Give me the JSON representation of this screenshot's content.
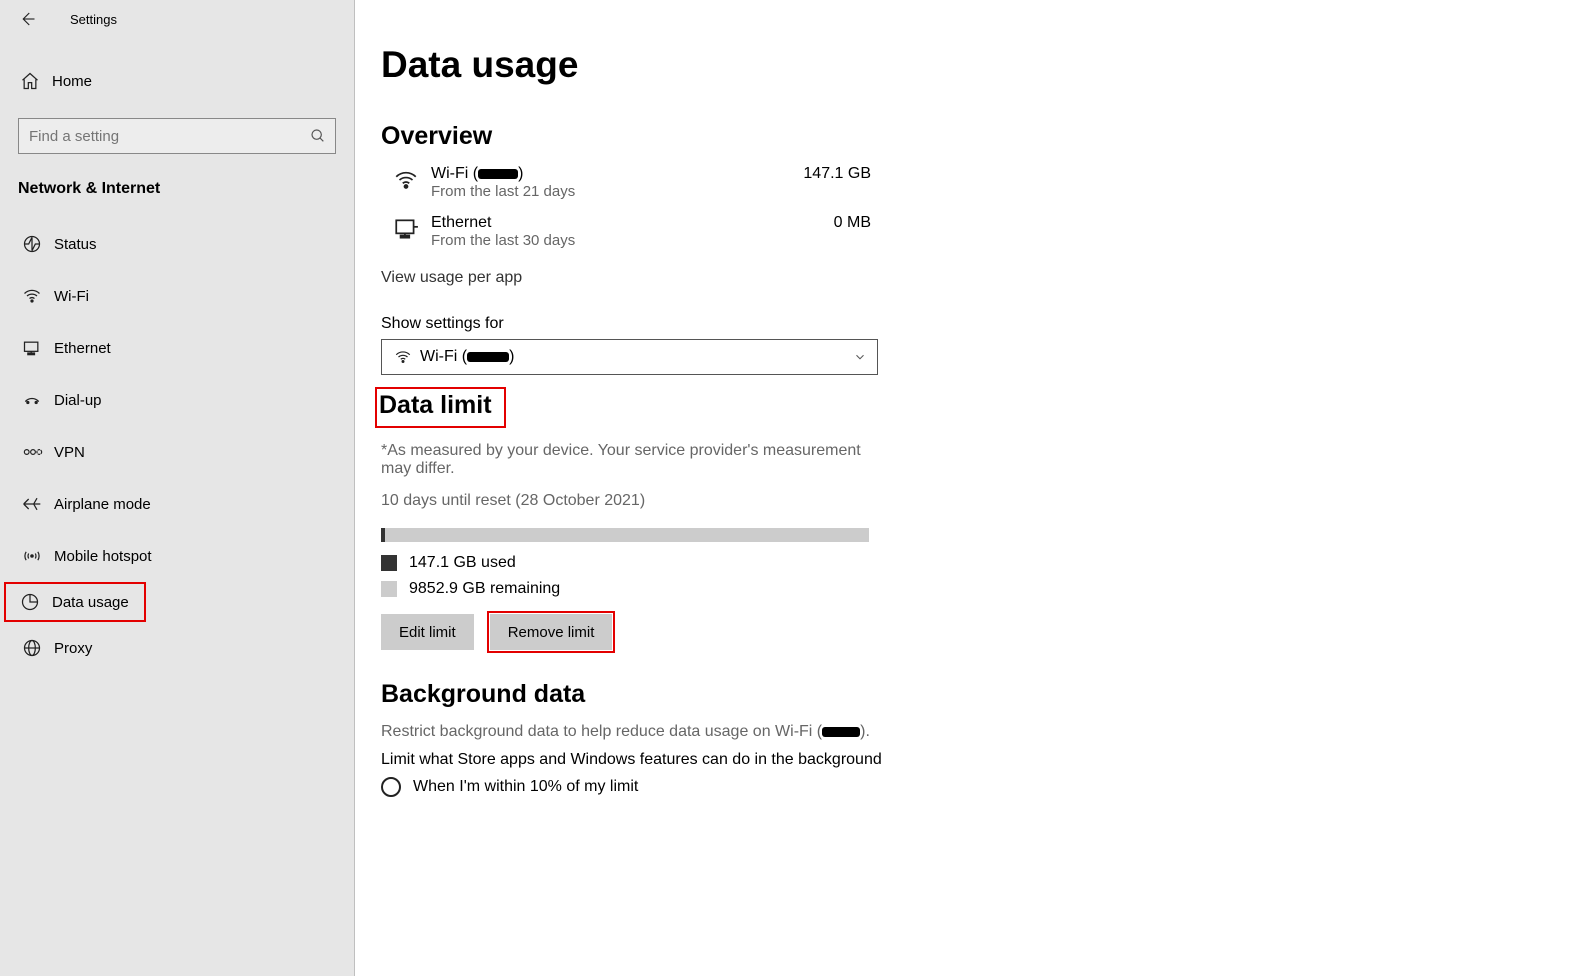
{
  "titlebar": {
    "title": "Settings"
  },
  "sidebar": {
    "home_label": "Home",
    "search_placeholder": "Find a setting",
    "section_title": "Network & Internet",
    "items": [
      {
        "label": "Status",
        "icon": "status"
      },
      {
        "label": "Wi-Fi",
        "icon": "wifi"
      },
      {
        "label": "Ethernet",
        "icon": "ethernet"
      },
      {
        "label": "Dial-up",
        "icon": "dialup"
      },
      {
        "label": "VPN",
        "icon": "vpn"
      },
      {
        "label": "Airplane mode",
        "icon": "airplane"
      },
      {
        "label": "Mobile hotspot",
        "icon": "hotspot"
      },
      {
        "label": "Data usage",
        "icon": "data"
      },
      {
        "label": "Proxy",
        "icon": "proxy"
      }
    ]
  },
  "main": {
    "page_title": "Data usage",
    "overview": {
      "heading": "Overview",
      "wifi": {
        "name_prefix": "Wi-Fi (",
        "name_suffix": ")",
        "sub": "From the last 21 days",
        "value": "147.1 GB"
      },
      "ethernet": {
        "name": "Ethernet",
        "sub": "From the last 30 days",
        "value": "0 MB"
      },
      "view_per_app": "View usage per app"
    },
    "show_settings": {
      "label": "Show settings for",
      "selected_prefix": "Wi-Fi (",
      "selected_suffix": ")"
    },
    "data_limit": {
      "heading": "Data limit",
      "note": "*As measured by your device. Your service provider's measurement may differ.",
      "reset_text": "10 days until reset (28 October 2021)",
      "used_text": "147.1 GB used",
      "remaining_text": "9852.9 GB remaining",
      "edit_btn": "Edit limit",
      "remove_btn": "Remove limit"
    },
    "background": {
      "heading": "Background data",
      "desc_prefix": "Restrict background data to help reduce data usage on Wi-Fi (",
      "desc_suffix": ").",
      "limit_text": "Limit what Store apps and Windows features can do in the background",
      "radio1": "When I'm within 10% of my limit"
    }
  }
}
